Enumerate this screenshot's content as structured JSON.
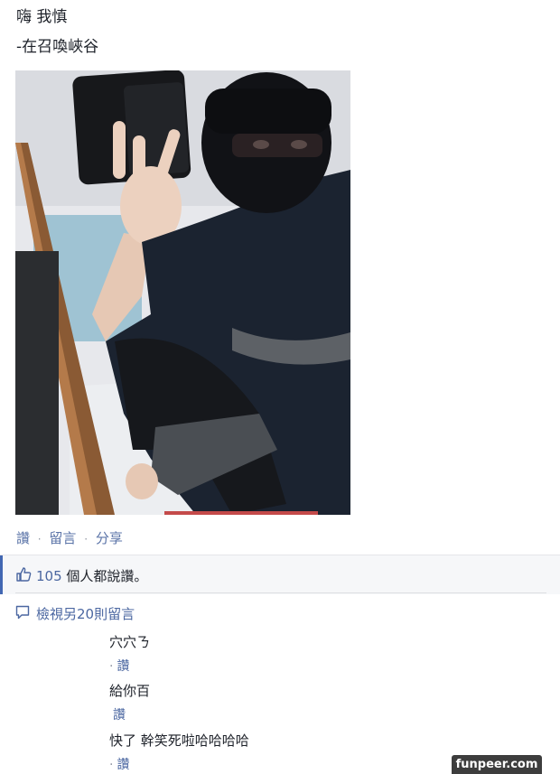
{
  "post": {
    "line1": "嗨 我慎",
    "line2": "-在召喚峽谷"
  },
  "photo": {
    "alt_icon": "mirror-selfie-photo"
  },
  "actions": {
    "like": "讚",
    "comment": "留言",
    "share": "分享",
    "separator": "·"
  },
  "likes": {
    "icon": "thumbs-up-icon",
    "count": "105",
    "text": " 個人都說讚。"
  },
  "view_more": {
    "icon": "comment-bubble-icon",
    "label": "檢視另20則留言"
  },
  "comments": [
    {
      "text": "穴穴ㄋ",
      "like": "讚",
      "dot": "·"
    },
    {
      "text": "給你百",
      "like": "讚",
      "dot": ""
    },
    {
      "text": "快了 幹笑死啦哈哈哈哈",
      "like": "讚",
      "dot": "·"
    }
  ],
  "watermark": "funpeer.com",
  "colors": {
    "link": "#4b67a1",
    "accent": "#4267b2",
    "likes_bg": "#f6f7f9"
  }
}
